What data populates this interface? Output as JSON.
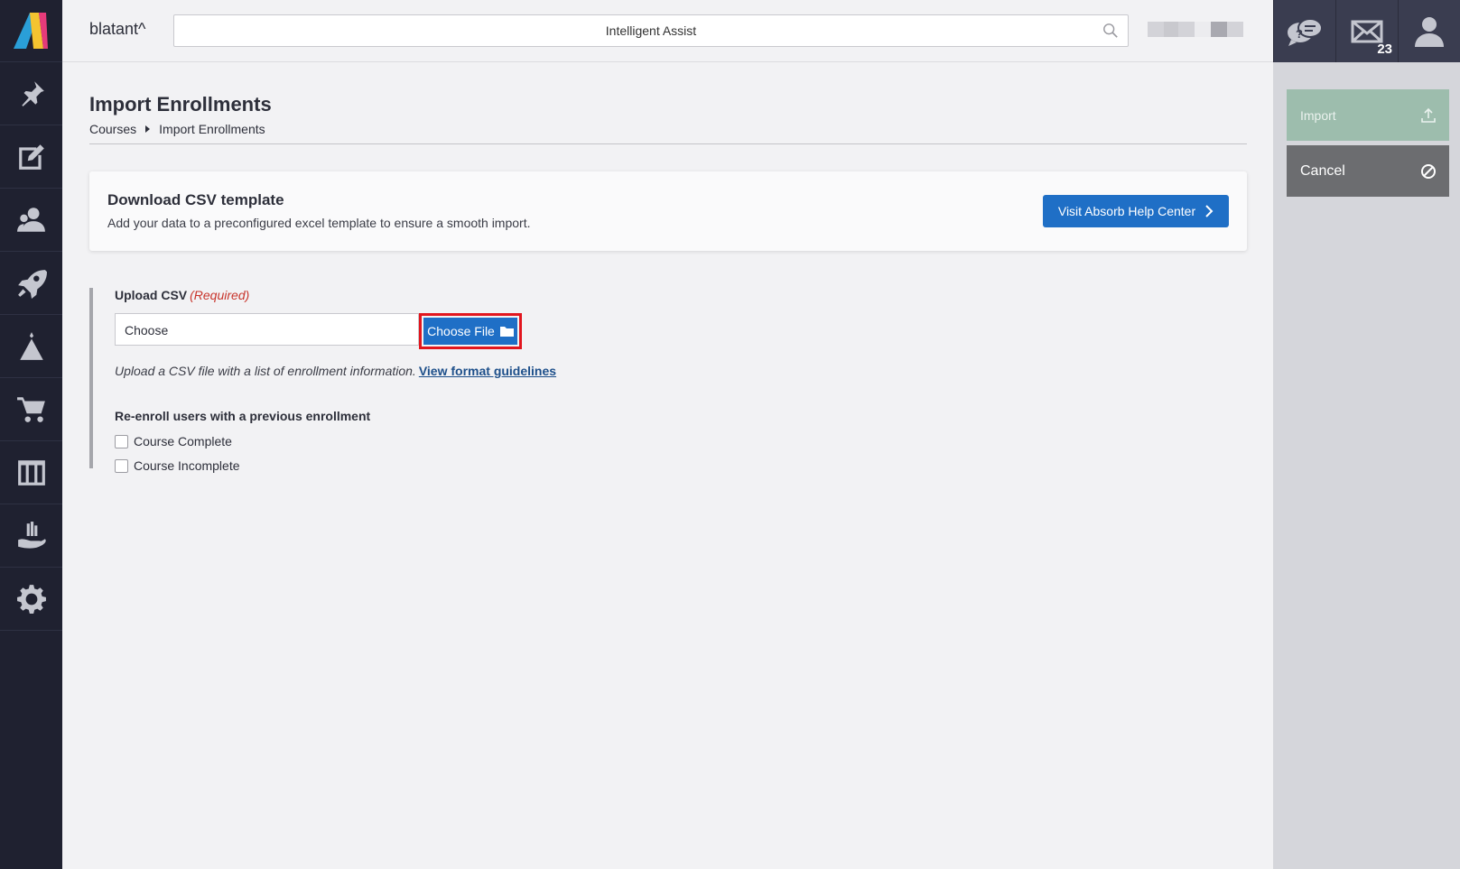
{
  "header": {
    "brand": "blatant^",
    "search_text": "Intelligent Assist",
    "messages_count": "23"
  },
  "sidebar": {
    "items": [
      {
        "icon": "pin-icon"
      },
      {
        "icon": "edit-icon"
      },
      {
        "icon": "users-icon"
      },
      {
        "icon": "rocket-icon"
      },
      {
        "icon": "competency-icon"
      },
      {
        "icon": "cart-icon"
      },
      {
        "icon": "columns-icon"
      },
      {
        "icon": "hand-icon"
      },
      {
        "icon": "gear-icon"
      }
    ]
  },
  "actions": {
    "import_label": "Import",
    "cancel_label": "Cancel"
  },
  "page": {
    "title": "Import Enrollments",
    "breadcrumb": [
      "Courses",
      "Import Enrollments"
    ]
  },
  "template_card": {
    "title": "Download CSV template",
    "description": "Add your data to a preconfigured excel template to ensure a smooth import.",
    "button_label": "Visit Absorb Help Center"
  },
  "upload": {
    "label": "Upload CSV",
    "required": "(Required)",
    "input_value": "Choose",
    "button_label": "Choose File",
    "hint": "Upload a CSV file with a list of enrollment information.",
    "hint_link": "View format guidelines"
  },
  "reenroll": {
    "label": "Re-enroll users with a previous enrollment",
    "options": [
      "Course Complete",
      "Course Incomplete"
    ]
  },
  "colors": {
    "sidebar": "#1f2130",
    "primary_button": "#1f6fc6",
    "import_button": "#9dbdad",
    "cancel_button": "#6c6d70",
    "highlight": "#e2161e",
    "required": "#c8342b"
  }
}
